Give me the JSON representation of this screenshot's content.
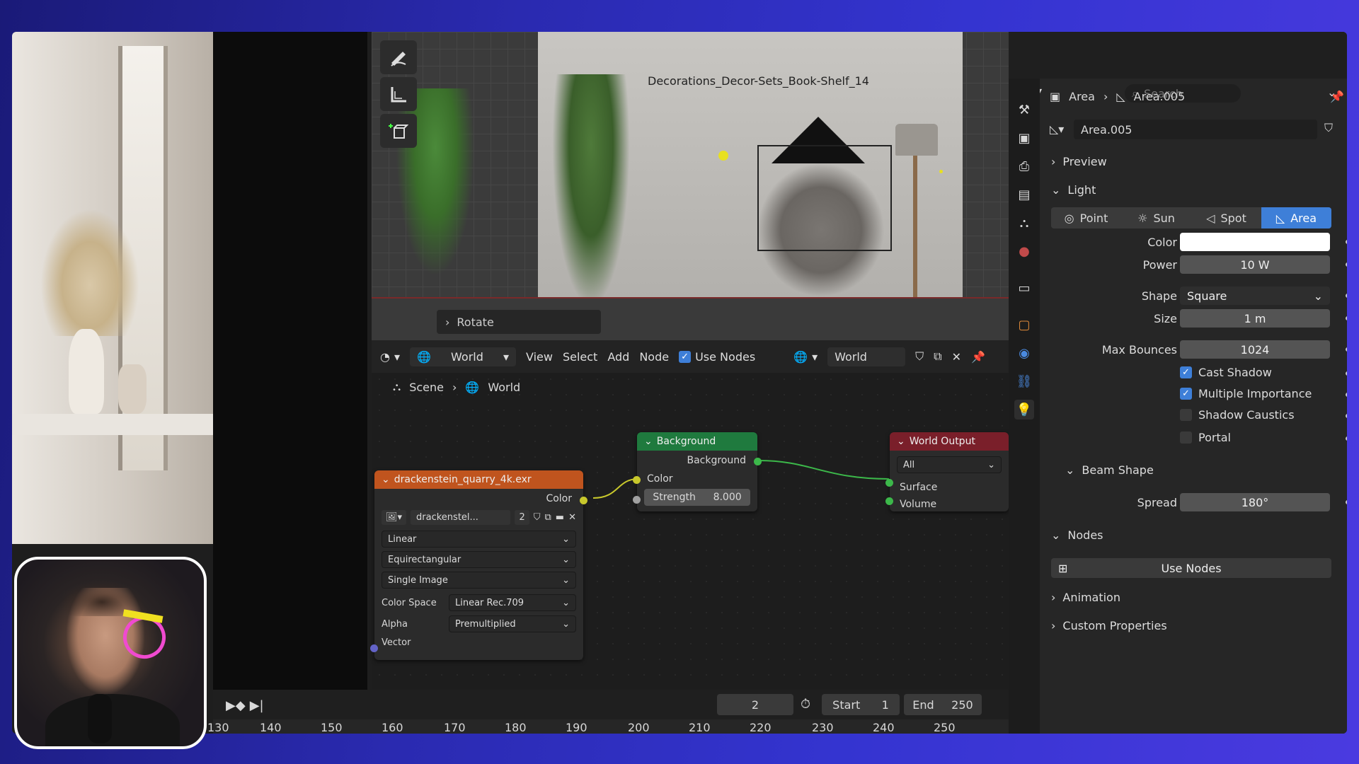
{
  "viewport": {
    "object_label": "Decorations_Decor-Sets_Book-Shelf_14",
    "rotate_label": "Rotate"
  },
  "node_editor": {
    "header": {
      "type_icon": "world-icon",
      "world_select": "World",
      "menu": [
        "View",
        "Select",
        "Add",
        "Node"
      ],
      "use_nodes": "Use Nodes",
      "datablock": "World"
    },
    "breadcrumb": {
      "scene": "Scene",
      "world": "World"
    },
    "image_node": {
      "title": "drackenstein_quarry_4k.exr",
      "output": "Color",
      "image_name": "drackenstel...",
      "users": "2",
      "interpolation": "Linear",
      "projection": "Equirectangular",
      "source": "Single Image",
      "color_space_label": "Color Space",
      "color_space": "Linear Rec.709",
      "alpha_label": "Alpha",
      "alpha": "Premultiplied",
      "vector": "Vector",
      "header_color": "#c0541e"
    },
    "background_node": {
      "title": "Background",
      "output": "Background",
      "color_input": "Color",
      "strength_label": "Strength",
      "strength_value": "8.000",
      "header_color": "#1f7a3e"
    },
    "output_node": {
      "title": "World Output",
      "target": "All",
      "surface": "Surface",
      "volume": "Volume",
      "header_color": "#7a1f2a"
    }
  },
  "timeline": {
    "current_frame": "2",
    "start_label": "Start",
    "start_value": "1",
    "end_label": "End",
    "end_value": "250",
    "ruler": [
      "130",
      "140",
      "150",
      "160",
      "170",
      "180",
      "190",
      "200",
      "210",
      "220",
      "230",
      "240",
      "250"
    ]
  },
  "properties": {
    "search_placeholder": "Search",
    "breadcrumb_object": "Area",
    "breadcrumb_data": "Area.005",
    "datablock_name": "Area.005",
    "sections": {
      "preview": "Preview",
      "light": "Light",
      "beam_shape": "Beam Shape",
      "nodes": "Nodes",
      "animation": "Animation",
      "custom_properties": "Custom Properties"
    },
    "light_types": [
      "Point",
      "Sun",
      "Spot",
      "Area"
    ],
    "active_light_type": "Area",
    "color_label": "Color",
    "color_value": "#ffffff",
    "power_label": "Power",
    "power_value": "10 W",
    "shape_label": "Shape",
    "shape_value": "Square",
    "size_label": "Size",
    "size_value": "1 m",
    "max_bounces_label": "Max Bounces",
    "max_bounces_value": "1024",
    "checkboxes": [
      {
        "label": "Cast Shadow",
        "checked": true
      },
      {
        "label": "Multiple Importance",
        "checked": true
      },
      {
        "label": "Shadow Caustics",
        "checked": false
      },
      {
        "label": "Portal",
        "checked": false
      }
    ],
    "spread_label": "Spread",
    "spread_value": "180°",
    "use_nodes_button": "Use Nodes",
    "accent_color": "#3e7fd8"
  }
}
